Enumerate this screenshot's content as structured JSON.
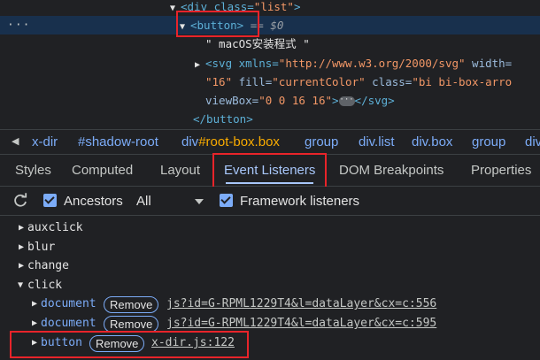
{
  "dom": {
    "line1": {
      "open": "<div class=",
      "val": "\"list\"",
      "close": ">"
    },
    "line2": {
      "tag": "<button>",
      "eq": " == $0"
    },
    "line3": {
      "text": "\" macOS安装程式 \""
    },
    "line4": {
      "a1": "<svg xmlns=",
      "v1": "\"http://www.w3.org/2000/svg\"",
      "a2": " width="
    },
    "line5": {
      "v1": "\"16\"",
      "a1": " fill=",
      "v2": "\"currentColor\"",
      "a2": " class=",
      "v3": "\"bi bi-box-arro"
    },
    "line6": {
      "a1": "viewBox=",
      "v1": "\"0 0 16 16\"",
      "pill": "···",
      "close": "</svg>"
    },
    "line7": {
      "tag": "</button>"
    },
    "dots": "···"
  },
  "breadcrumbs": [
    {
      "plain": "x-dir"
    },
    {
      "plain": "#shadow-root"
    },
    {
      "plain": "div",
      "hl": "#root-box.box"
    },
    {
      "plain": "group"
    },
    {
      "plain": "div.list"
    },
    {
      "plain": "div.box"
    },
    {
      "plain": "group"
    },
    {
      "plain": "div"
    }
  ],
  "tabs": [
    "Styles",
    "Computed",
    "Layout",
    "Event Listeners",
    "DOM Breakpoints",
    "Properties"
  ],
  "active_tab": "Event Listeners",
  "toolbar": {
    "ancestors": "Ancestors",
    "all": "All",
    "framework": "Framework listeners"
  },
  "listeners": {
    "events": [
      "auxclick",
      "blur",
      "change",
      "click"
    ],
    "click_entries": [
      {
        "node": "document",
        "remove": "Remove",
        "link": "js?id=G-RPML1229T4&l=dataLayer&cx=c:556"
      },
      {
        "node": "document",
        "remove": "Remove",
        "link": "js?id=G-RPML1229T4&l=dataLayer&cx=c:595"
      },
      {
        "node": "button",
        "remove": "Remove",
        "link": "x-dir.js:122"
      }
    ]
  },
  "colors": {
    "highlight": "#e8242a",
    "accent": "#7cacf8",
    "selected_row": "#18304d"
  }
}
